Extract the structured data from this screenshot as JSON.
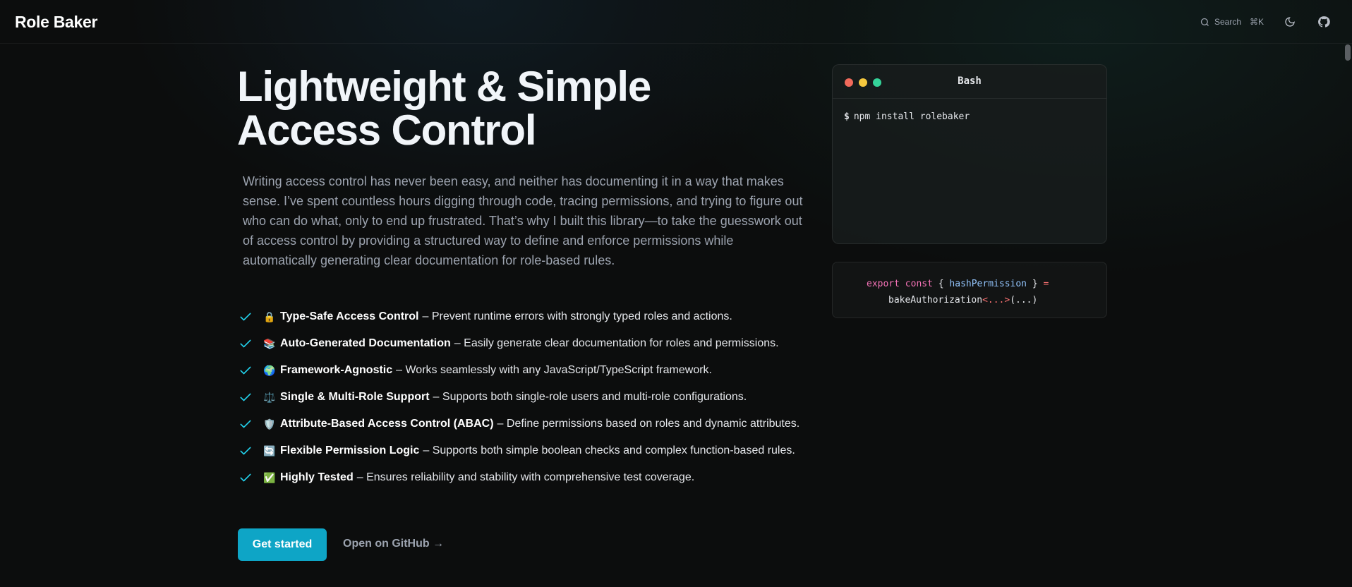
{
  "header": {
    "brand": "Role Baker",
    "search_label": "Search",
    "search_shortcut": "⌘K",
    "icons": [
      "search-icon",
      "moon-icon",
      "github-icon"
    ]
  },
  "hero": {
    "title": "Lightweight & Simple Access Control",
    "description": "Writing access control has never been easy, and neither has documenting it in a way that makes sense. I’ve spent countless hours digging through code, tracing permissions, and trying to figure out who can do what, only to end up frustrated. That’s why I built this library—to take the guesswork out of access control by providing a structured way to define and enforce permissions while automatically generating clear documentation for role-based rules."
  },
  "features": [
    {
      "emoji": "🔒",
      "title": "Type-Safe Access Control",
      "text": "– Prevent runtime errors with strongly typed roles and actions."
    },
    {
      "emoji": "📚",
      "title": "Auto-Generated Documentation",
      "text": "– Easily generate clear documentation for roles and permissions."
    },
    {
      "emoji": "🌍",
      "title": "Framework-Agnostic",
      "text": "– Works seamlessly with any JavaScript/TypeScript framework."
    },
    {
      "emoji": "⚖️",
      "title": "Single & Multi-Role Support",
      "text": "– Supports both single-role users and multi-role configurations."
    },
    {
      "emoji": "🛡️",
      "title": "Attribute-Based Access Control (ABAC)",
      "text": "– Define permissions based on roles and dynamic attributes."
    },
    {
      "emoji": "🔄",
      "title": "Flexible Permission Logic",
      "text": "– Supports both simple boolean checks and complex function-based rules."
    },
    {
      "emoji": "✅",
      "title": "Highly Tested",
      "text": "– Ensures reliability and stability with comprehensive test coverage."
    }
  ],
  "actions": {
    "primary": "Get started",
    "secondary": "Open on GitHub →"
  },
  "terminal": {
    "title": "Bash",
    "prompt": "$",
    "command": "npm install rolebaker"
  },
  "code": {
    "kw_export": "export",
    "kw_const": "const",
    "brace_open": "{",
    "name": "hashPermission",
    "brace_close": "}",
    "equals": "=",
    "call": "bakeAuthorization",
    "generic": "<...>",
    "args": "(...)"
  },
  "colors": {
    "accent": "#0ea5c6",
    "check": "#22d3ee",
    "background": "#0c0d0d"
  }
}
